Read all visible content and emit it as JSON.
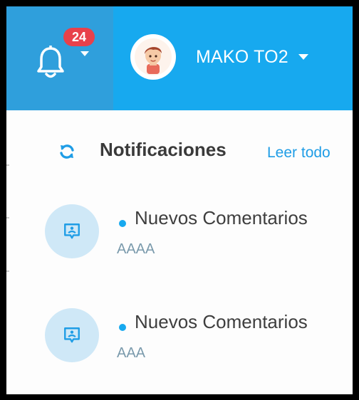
{
  "topbar": {
    "notification_count": "24",
    "user": {
      "name": "MAKO TO2"
    }
  },
  "notifications": {
    "title": "Notificaciones",
    "read_all": "Leer todo",
    "items": [
      {
        "title": "Nuevos Comentarios",
        "subtitle": "AAAA"
      },
      {
        "title": "Nuevos Comentarios",
        "subtitle": "AAA"
      }
    ]
  },
  "colors": {
    "topbar": "#17a9ef",
    "bell_zone": "#2f9fdc",
    "badge": "#e8414b",
    "accent": "#1f9de6",
    "icon_bg": "#cfe8f7"
  },
  "icons": [
    "bell-icon",
    "chevron-down-icon",
    "refresh-icon",
    "comment-icon"
  ]
}
